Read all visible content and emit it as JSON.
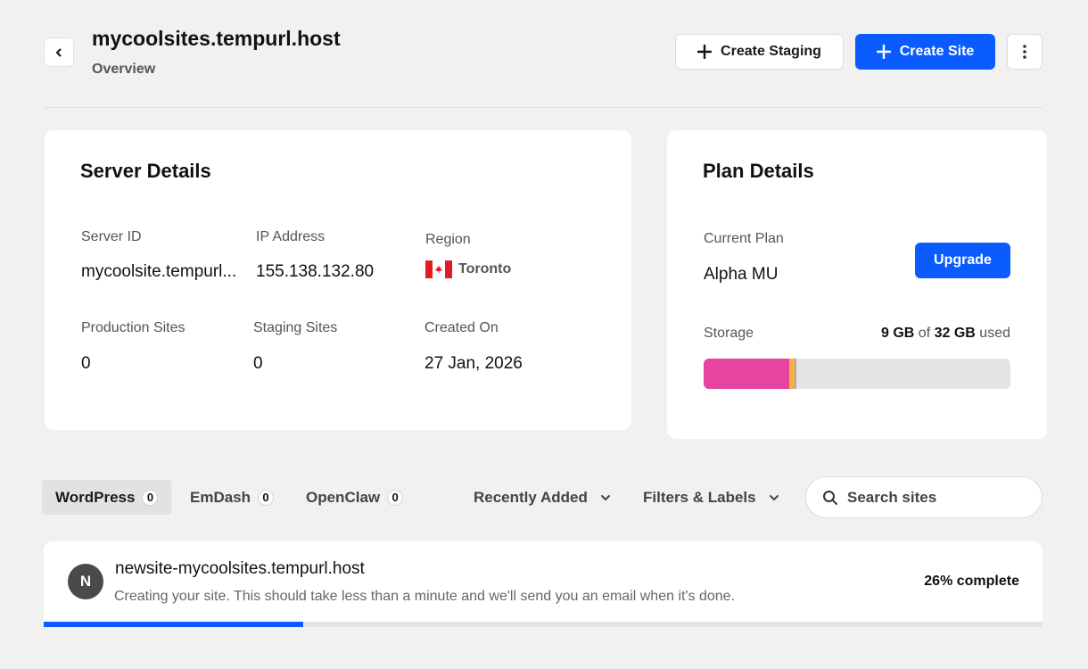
{
  "header": {
    "title": "mycoolsites.tempurl.host",
    "subtitle": "Overview",
    "create_staging_label": "Create Staging",
    "create_site_label": "Create Site"
  },
  "server": {
    "title": "Server Details",
    "server_id_label": "Server ID",
    "server_id": "mycoolsite.tempurl...",
    "ip_label": "IP Address",
    "ip": "155.138.132.80",
    "region_label": "Region",
    "region": "Toronto",
    "production_label": "Production Sites",
    "production_count": "0",
    "staging_label": "Staging Sites",
    "staging_count": "0",
    "created_label": "Created On",
    "created_on": "27 Jan, 2026"
  },
  "plan": {
    "title": "Plan Details",
    "current_plan_label": "Current Plan",
    "current_plan": "Alpha MU",
    "upgrade_label": "Upgrade",
    "storage_label": "Storage",
    "storage_used": "9 GB",
    "storage_of": "of",
    "storage_total": "32 GB",
    "storage_suffix": "used",
    "storage_fraction": 0.28
  },
  "tabs": [
    {
      "label": "WordPress",
      "count": "0"
    },
    {
      "label": "EmDash",
      "count": "0"
    },
    {
      "label": "OpenClaw",
      "count": "0"
    }
  ],
  "filters": {
    "sort_label": "Recently Added",
    "filters_label": "Filters & Labels",
    "search_placeholder": "Search sites"
  },
  "site": {
    "avatar_letter": "N",
    "name": "newsite-mycoolsites.tempurl.host",
    "message": "Creating your site. This should take less than a minute and we'll send you an email when it's done.",
    "progress_text": "26% complete",
    "progress": 0.26
  },
  "colors": {
    "accent": "#0a5cff",
    "storage_primary": "#e5459f",
    "storage_secondary": "#f5b13d"
  }
}
